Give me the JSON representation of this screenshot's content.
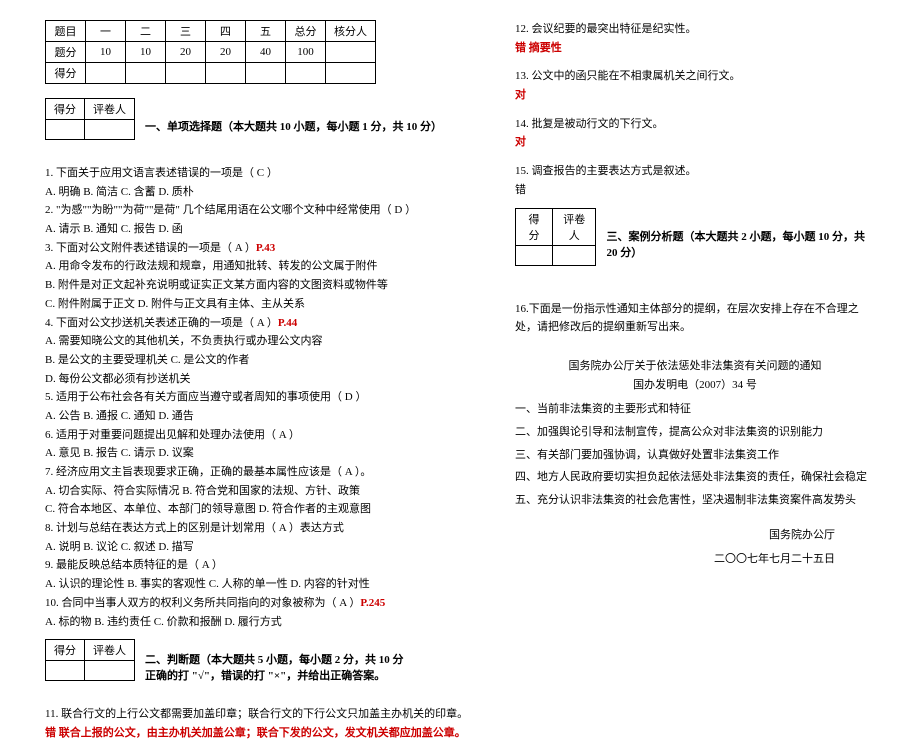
{
  "score_table": {
    "headers": [
      "题目",
      "一",
      "二",
      "三",
      "四",
      "五",
      "总分",
      "核分人"
    ],
    "row1_label": "题分",
    "row1": [
      "10",
      "10",
      "20",
      "20",
      "40",
      "100",
      ""
    ],
    "row2_label": "得分",
    "row2": [
      "",
      "",
      "",
      "",
      "",
      "",
      ""
    ]
  },
  "mini_table": {
    "c1": "得分",
    "c2": "评卷人"
  },
  "section1": {
    "title": "一、单项选择题（本大题共 10 小题，每小题 1 分，共 10 分）",
    "q1": "1. 下面关于应用文语言表述错误的一项是（   C   ）",
    "q1a": "A. 明确    B. 简洁    C. 含蓄    D. 质朴",
    "q2": "2. \"为感\"\"为盼\"\"为荷\"\"是荷\" 几个结尾用语在公文哪个文种中经常使用（ D   ）",
    "q2a": "A. 请示    B. 通知    C. 报告    D. 函",
    "q3": "3. 下面对公文附件表述错误的一项是（   A   ）",
    "q3p": "P.43",
    "q3a": "A. 用命令发布的行政法规和规章，用通知批转、转发的公文属于附件",
    "q3b": "B. 附件是对正文起补充说明或证实正文某方面内容的文图资料或物件等",
    "q3c": "C. 附件附属于正文               D. 附件与正文具有主体、主从关系",
    "q4": "4. 下面对公文抄送机关表述正确的一项是（   A   ）",
    "q4p": "P.44",
    "q4a": "A. 需要知晓公文的其他机关，不负责执行或办理公文内容",
    "q4b": "B. 是公文的主要受理机关     C. 是公文的作者",
    "q4c": "D. 每份公文都必须有抄送机关",
    "q5": "5. 适用于公布社会各有关方面应当遵守或者周知的事项使用（   D   ）",
    "q5a": "A. 公告  B. 通报   C. 通知   D. 通告",
    "q6": "6. 适用于对重要问题提出见解和处理办法使用（   A   ）",
    "q6a": "A. 意见   B. 报告   C. 请示       D. 议案",
    "q7": "7. 经济应用文主旨表现要求正确，正确的最基本属性应该是（  A  ）。",
    "q7a": "A. 切合实际、符合实际情况    B. 符合党和国家的法规、方针、政策",
    "q7b": "C. 符合本地区、本单位、本部门的领导意图   D. 符合作者的主观意图",
    "q8": "8. 计划与总结在表达方式上的区别是计划常用（  A  ）表达方式",
    "q8a": "A. 说明    B. 议论       C. 叙述    D. 描写",
    "q9": "9. 最能反映总结本质特征的是（   A  ）",
    "q9a": "A. 认识的理论性   B. 事实的客观性  C. 人称的单一性  D. 内容的针对性",
    "q10": "10. 合同中当事人双方的权利义务所共同指向的对象被称为（ A   ）",
    "q10p": "P.245",
    "q10a": "A. 标的物    B. 违约责任   C. 价款和报酬   D. 履行方式"
  },
  "section2": {
    "title": "二、判断题（本大题共 5 小题，每小题 2 分，共 10 分",
    "subtitle": "正确的打 \"√\"，错误的打 \"×\"，并给出正确答案。",
    "q11": "11. 联合行文的上行公文都需要加盖印章；联合行文的下行公文只加盖主办机关的印章。",
    "q11ans": "错   联合上报的公文，由主办机关加盖公章；联合下发的公文，发文机关都应加盖公章。"
  },
  "right_col": {
    "q12": "12. 会议纪要的最突出特征是纪实性。",
    "q12ans": "错   摘要性",
    "q13": "13. 公文中的函只能在不相隶属机关之间行文。",
    "q13ans": "对",
    "q14": "14. 批复是被动行文的下行文。",
    "q14ans": "对",
    "q15": "15. 调查报告的主要表达方式是叙述。",
    "q15ans": "错"
  },
  "section3": {
    "title": "三、案例分析题（本大题共 2 小题，每小题 10 分，共 20 分）",
    "q16": "16.下面是一份指示性通知主体部分的提纲，在层次安排上存在不合理之处，请把修改后的提纲重新写出来。",
    "doc_title": "国务院办公厅关于依法惩处非法集资有关问题的通知",
    "doc_num": "国办发明电（2007）34 号",
    "p1": "一、当前非法集资的主要形式和特征",
    "p2": "二、加强舆论引导和法制宣传，提高公众对非法集资的识别能力",
    "p3": "三、有关部门要加强协调，认真做好处置非法集资工作",
    "p4": "四、地方人民政府要切实担负起依法惩处非法集资的责任，确保社会稳定",
    "p5": "五、充分认识非法集资的社会危害性，坚决遏制非法集资案件高发势头",
    "sign": "国务院办公厅",
    "date": "二〇〇七年七月二十五日"
  }
}
